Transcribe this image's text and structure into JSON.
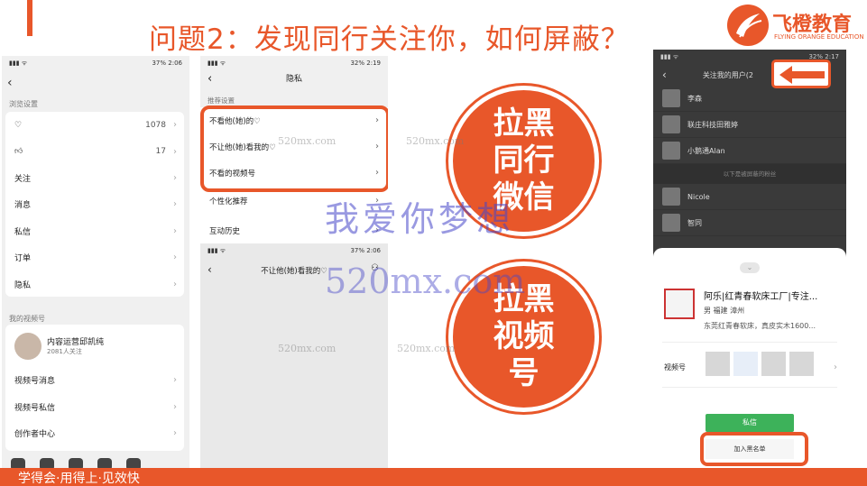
{
  "slide": {
    "title": "问题2：发现同行关注你，如何屏蔽？",
    "footer": "学得会·用得上·见效快",
    "accent_color": "#e8572a"
  },
  "logo": {
    "name": "飞橙教育",
    "sub": "FLYING ORANGE EDUCATION"
  },
  "phone1": {
    "status_time": "2:06",
    "status_battery": "37%",
    "section_browse": "浏览设置",
    "rows": [
      {
        "icon": "heart-icon",
        "label": "",
        "value": "1078"
      },
      {
        "icon": "thumbs-up-icon",
        "label": "",
        "value": "17"
      },
      {
        "label": "关注",
        "value": ""
      },
      {
        "label": "消息",
        "value": ""
      },
      {
        "label": "私信",
        "value": ""
      },
      {
        "label": "订单",
        "value": ""
      },
      {
        "label": "隐私",
        "value": ""
      }
    ],
    "section_channel": "我的视频号",
    "profile_name": "内容运营邱凯纯",
    "profile_followers": "2081人关注",
    "channel_rows": [
      "视频号消息",
      "视频号私信",
      "创作者中心"
    ]
  },
  "phone2": {
    "status_time": "2:19",
    "status_battery": "32%",
    "header": "隐私",
    "section": "推荐设置",
    "rows": [
      "不看他(她)的♡",
      "不让他(她)看我的♡",
      "不看的视频号"
    ],
    "extra_rows": [
      "个性化推荐",
      "互动历史"
    ],
    "lower_status_time": "2:06",
    "lower_status_battery": "37%",
    "lower_header": "不让他(她)看我的♡"
  },
  "bubbles": {
    "first": [
      "拉黑",
      "同行",
      "微信"
    ],
    "second": [
      "拉黑",
      "视频",
      "号"
    ]
  },
  "phone3": {
    "status_time": "2:17",
    "status_battery": "32%",
    "header": "关注我的用户(2",
    "list": [
      "李森",
      "联庄科技田雅婷",
      "小鹅通Alan"
    ],
    "divider": "以下是被屏蔽的粉丝",
    "list2": [
      "Nicole",
      "智同"
    ],
    "sheet": {
      "name": "阿乐|红青春软床工厂|专注...",
      "location": "男  福建 漳州",
      "desc": "东莞红青春软床，真皮实木1600...",
      "video_label": "视频号",
      "message_button": "私信",
      "block_button": "加入黑名单"
    }
  },
  "watermarks": {
    "big": "我爱你梦想",
    "url": "520mx.com",
    "small": "520mx.com"
  }
}
